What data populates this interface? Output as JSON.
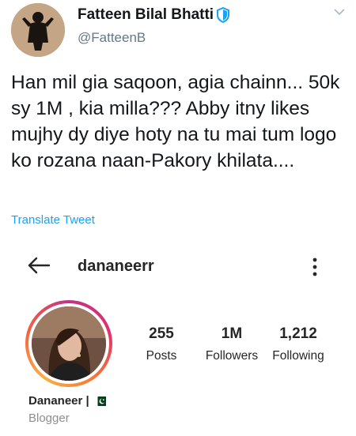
{
  "tweet": {
    "author_name": "Fatteen Bilal Bhatti",
    "handle": "@FatteenB",
    "text": "Han mil gia saqoon, agia chainn... 50k sy 1M , kia milla??? Abby itny likes mujhy dy diye hoty na tu mai tum logo ko rozana naan-Pakory khilata....",
    "translate_label": "Translate Tweet",
    "colors": {
      "link": "#1da1f2",
      "handle": "#657786",
      "verified": "#1da1f2"
    }
  },
  "instagram": {
    "username": "dananeerr",
    "stats": [
      {
        "value": "255",
        "label": "Posts"
      },
      {
        "value": "1M",
        "label": "Followers"
      },
      {
        "value": "1,212",
        "label": "Following"
      }
    ],
    "display_name": "Dananeer |",
    "category": "Blogger",
    "icons": [
      "back-arrow-icon",
      "more-vertical-icon",
      "pakistan-flag-icon"
    ]
  }
}
